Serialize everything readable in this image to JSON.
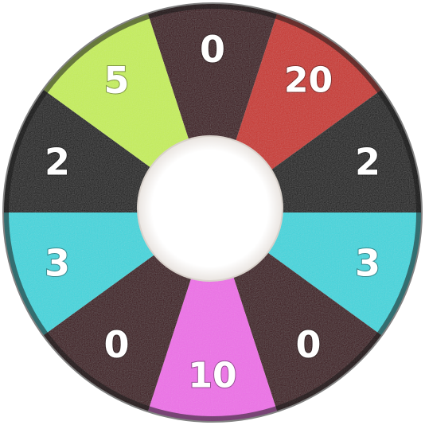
{
  "wheel": {
    "segments": [
      {
        "label": "0",
        "color": "#3a0f12"
      },
      {
        "label": "20",
        "color": "#c9302c"
      },
      {
        "label": "2",
        "color": "#141414"
      },
      {
        "label": "3",
        "color": "#40d6dd"
      },
      {
        "label": "0",
        "color": "#3a0f12"
      },
      {
        "label": "10",
        "color": "#ee6fe8"
      },
      {
        "label": "0",
        "color": "#3a0f12"
      },
      {
        "label": "3",
        "color": "#40d6dd"
      },
      {
        "label": "2",
        "color": "#141414"
      },
      {
        "label": "5",
        "color": "#c6ef5a"
      }
    ],
    "hub_color": "#ffffff",
    "rim_color": "#1a1a1a"
  }
}
